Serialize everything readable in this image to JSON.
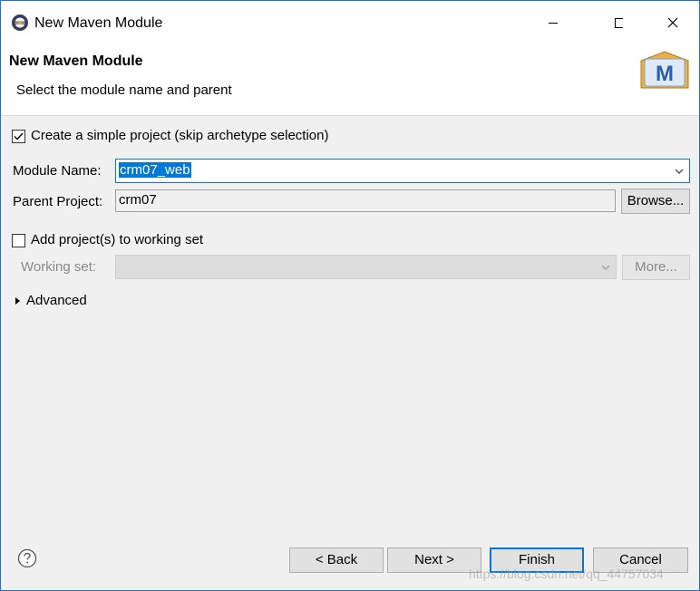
{
  "window": {
    "title": "New Maven Module",
    "controls": {
      "minimize": "minimize",
      "maximize": "maximize",
      "close": "close"
    }
  },
  "header": {
    "title": "New Maven Module",
    "description": "Select the module name and parent",
    "logo_letter": "M"
  },
  "form": {
    "simple_project": {
      "label": "Create a simple project (skip archetype selection)",
      "checked": true
    },
    "module_name": {
      "label": "Module Name:",
      "value": "crm07_web"
    },
    "parent_project": {
      "label": "Parent Project:",
      "value": "crm07",
      "browse_label": "Browse..."
    },
    "working_set_checkbox": {
      "label": "Add project(s) to working set",
      "checked": false
    },
    "working_set": {
      "label": "Working set:",
      "value": "",
      "more_label": "More..."
    },
    "advanced": {
      "label": "Advanced"
    }
  },
  "footer": {
    "back_label": "< Back",
    "next_label": "Next >",
    "finish_label": "Finish",
    "cancel_label": "Cancel"
  },
  "watermark": "https://blog.csdn.net/qq_44757034",
  "colors": {
    "accent": "#0078d7",
    "title_border": "#1f6fd6"
  }
}
